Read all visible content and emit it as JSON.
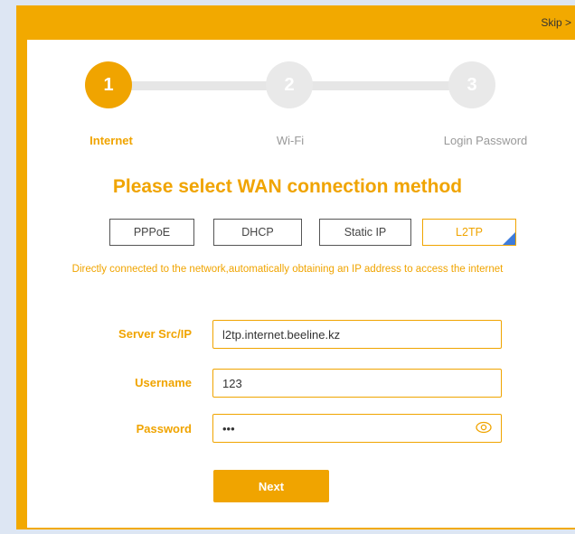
{
  "header": {
    "skip_label": "Skip >"
  },
  "stepper": {
    "steps": [
      {
        "number": "1",
        "label": "Internet"
      },
      {
        "number": "2",
        "label": "Wi-Fi"
      },
      {
        "number": "3",
        "label": "Login Password"
      }
    ],
    "active_step": 1
  },
  "wan": {
    "heading": "Please select WAN connection method",
    "methods": [
      "PPPoE",
      "DHCP",
      "Static IP",
      "L2TP"
    ],
    "selected": "L2TP",
    "description": "Directly connected to the network,automatically obtaining an IP address to access the internet"
  },
  "form": {
    "server": {
      "label": "Server Src/IP",
      "value": "l2tp.internet.beeline.kz"
    },
    "username": {
      "label": "Username",
      "value": "123"
    },
    "password": {
      "label": "Password",
      "value": "•••"
    }
  },
  "next_label": "Next",
  "colors": {
    "accent": "#f0a400",
    "selected_corner": "#3d7cdb",
    "inactive_step": "#e9e9e9"
  }
}
